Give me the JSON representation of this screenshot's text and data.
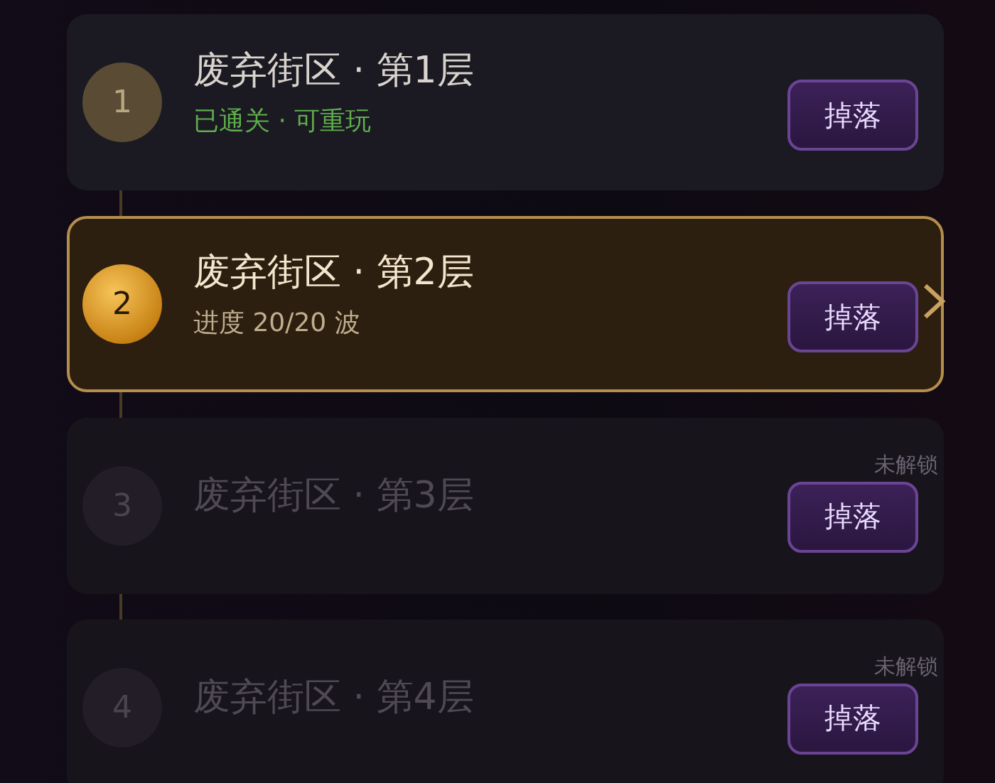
{
  "stages": [
    {
      "kind": "cleared",
      "number": "1",
      "title": "废弃街区 · 第1层",
      "subtitle": "已通关 · 可重玩",
      "button": "掉落"
    },
    {
      "kind": "current",
      "number": "2",
      "title": "废弃街区 · 第2层",
      "subtitle": "进度 20/20 波",
      "button": "掉落"
    },
    {
      "kind": "locked",
      "number": "3",
      "title": "废弃街区 · 第3层",
      "status": "未解锁",
      "button": "掉落"
    },
    {
      "kind": "locked",
      "number": "4",
      "title": "废弃街区 · 第4层",
      "status": "未解锁",
      "button": "掉落"
    }
  ]
}
